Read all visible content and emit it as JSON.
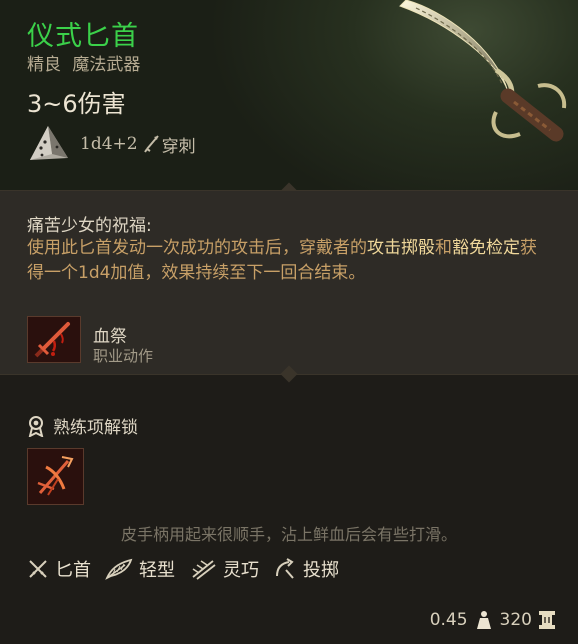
{
  "item": {
    "name": "仪式匕首",
    "rarity": "精良",
    "category": "魔法武器",
    "damage": "3~6伤害",
    "dice": "1d4+2",
    "damage_type": "穿刺"
  },
  "passive": {
    "title": "痛苦少女的祝福:",
    "text_1": "使用此匕首发动一次成功的攻击后，穿戴者的",
    "hl_1": "攻击掷骰",
    "text_2": "和",
    "hl_2": "豁免检定",
    "text_3": "获得一个1d4加值，效果持续至下一回合结束。"
  },
  "action": {
    "name": "血祭",
    "type": "职业动作",
    "icon": "blood-dagger-icon"
  },
  "proficiency": {
    "title": "熟练项解锁",
    "icon": "weapon-skill-icon"
  },
  "flavor": "皮手柄用起来很顺手，沾上鲜血后会有些打滑。",
  "traits": [
    {
      "label": "匕首",
      "icon": "dagger-icon"
    },
    {
      "label": "轻型",
      "icon": "feather-icon"
    },
    {
      "label": "灵巧",
      "icon": "finesse-icon"
    },
    {
      "label": "投掷",
      "icon": "thrown-icon"
    }
  ],
  "footer": {
    "weight": "0.45",
    "value": "320",
    "weight_icon": "weight-icon",
    "value_icon": "gold-coin-icon"
  },
  "colors": {
    "name_green": "#3bd14a",
    "highlight": "#efd79a",
    "body_gold": "#c8a067"
  }
}
